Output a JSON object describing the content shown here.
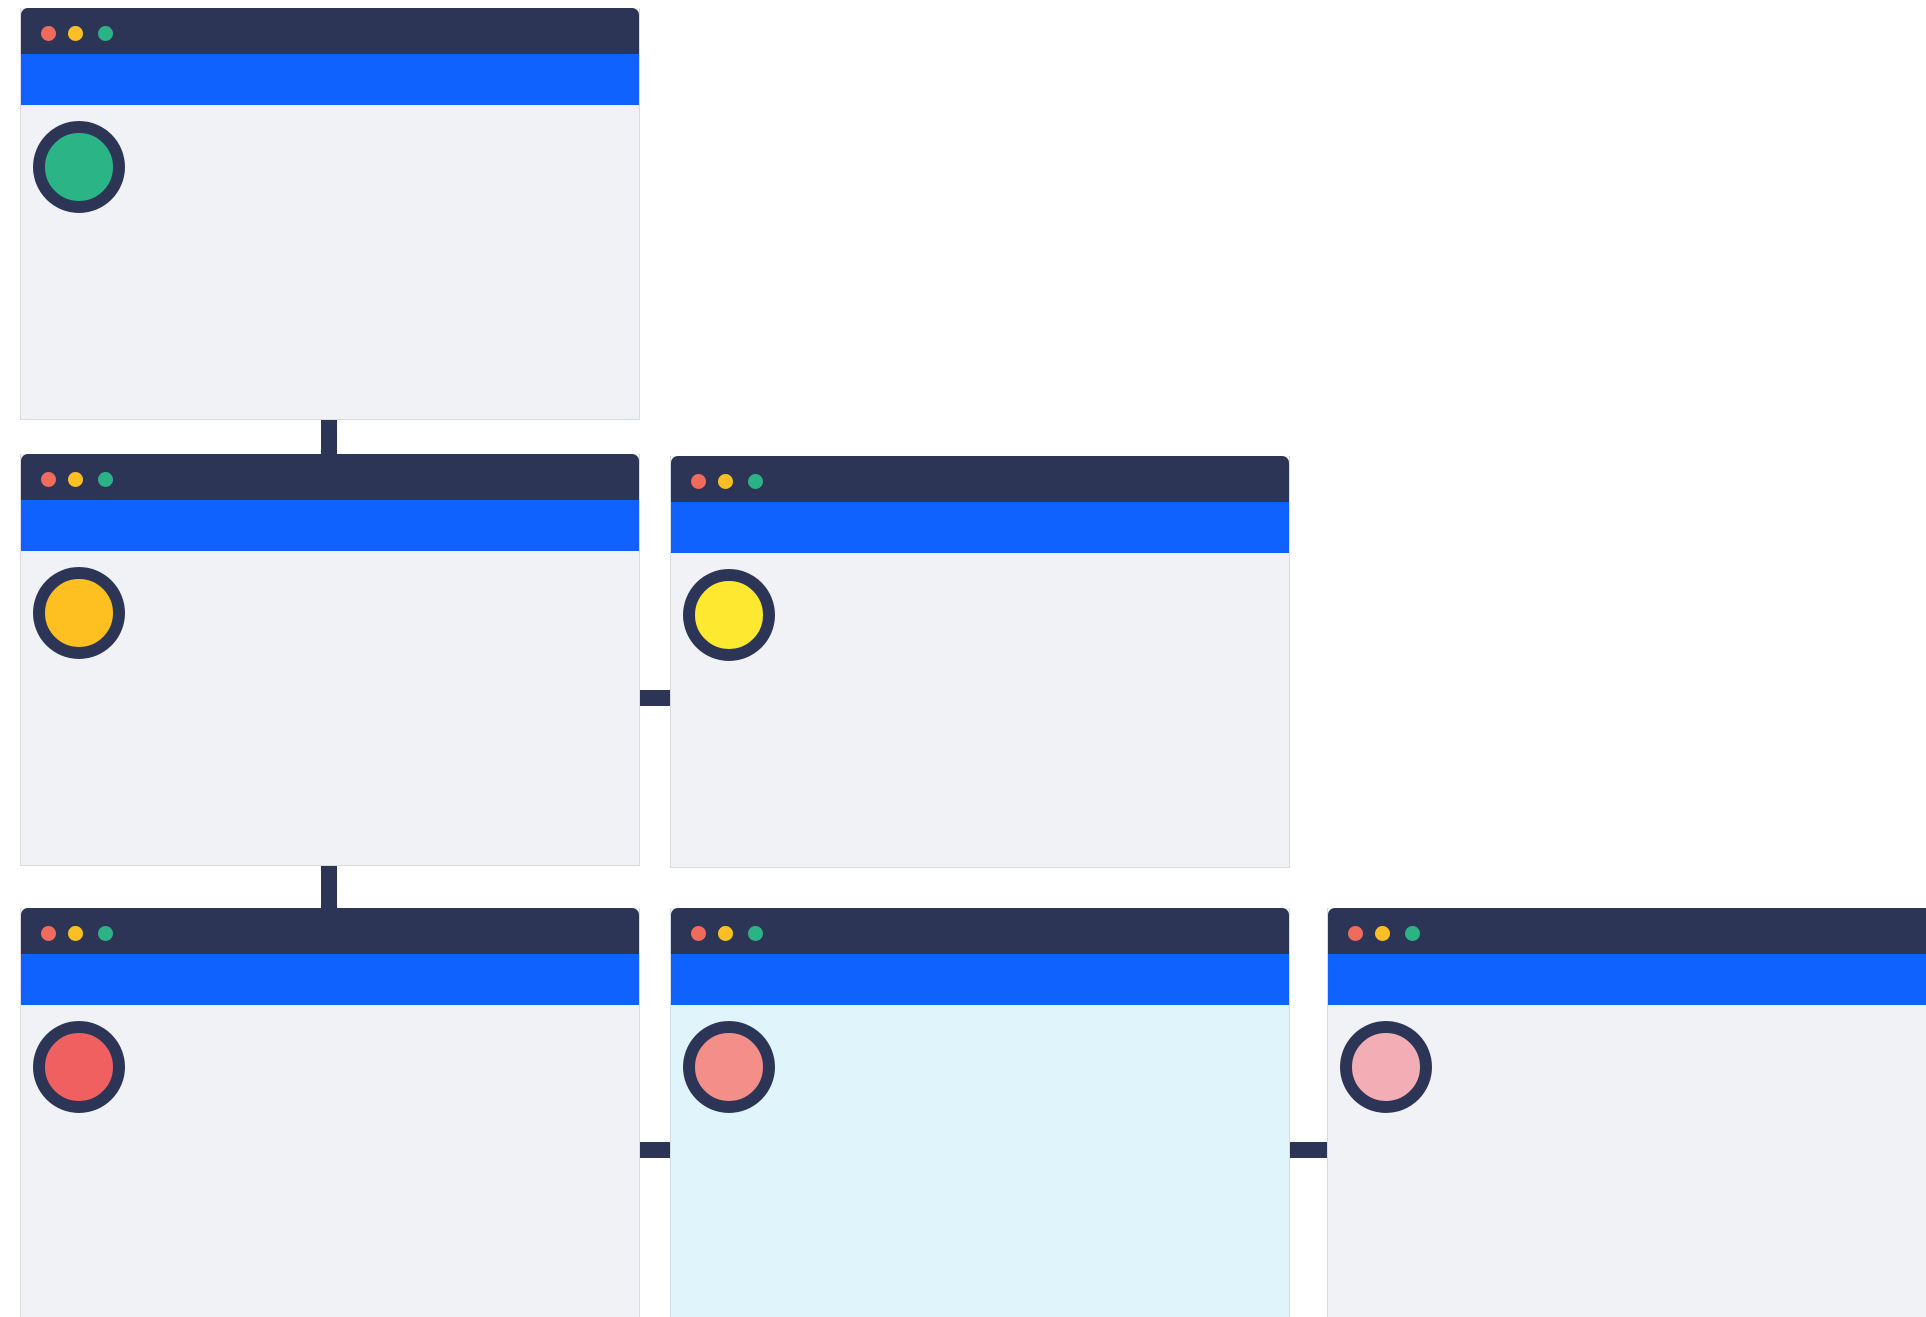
{
  "colors": {
    "titlebar": "#2d3557",
    "toolbar": "#0f62fe",
    "content": "#f1f2f6",
    "content_highlight": "#dff5fb",
    "connector": "#2d3557",
    "dot_red": "#ef6b5b",
    "dot_yellow": "#fbbf24",
    "dot_green": "#2bb386"
  },
  "windows": [
    {
      "id": "r1c1",
      "status_color": "#2bb586",
      "highlighted": false
    },
    {
      "id": "r2c1",
      "status_color": "#fdc020",
      "highlighted": false
    },
    {
      "id": "r2c2",
      "status_color": "#ffe830",
      "highlighted": false
    },
    {
      "id": "r3c1",
      "status_color": "#f06060",
      "highlighted": false
    },
    {
      "id": "r3c2",
      "status_color": "#f38f88",
      "highlighted": true
    },
    {
      "id": "r3c3",
      "status_color": "#f3aeb5",
      "highlighted": false
    }
  ],
  "connectors": [
    {
      "from": "r1c1",
      "to": "r2c1",
      "direction": "vertical"
    },
    {
      "from": "r2c1",
      "to": "r3c1",
      "direction": "vertical"
    },
    {
      "from": "r2c1",
      "to": "r2c2",
      "direction": "horizontal"
    },
    {
      "from": "r3c1",
      "to": "r3c2",
      "direction": "horizontal"
    },
    {
      "from": "r3c2",
      "to": "r3c3",
      "direction": "horizontal"
    }
  ]
}
